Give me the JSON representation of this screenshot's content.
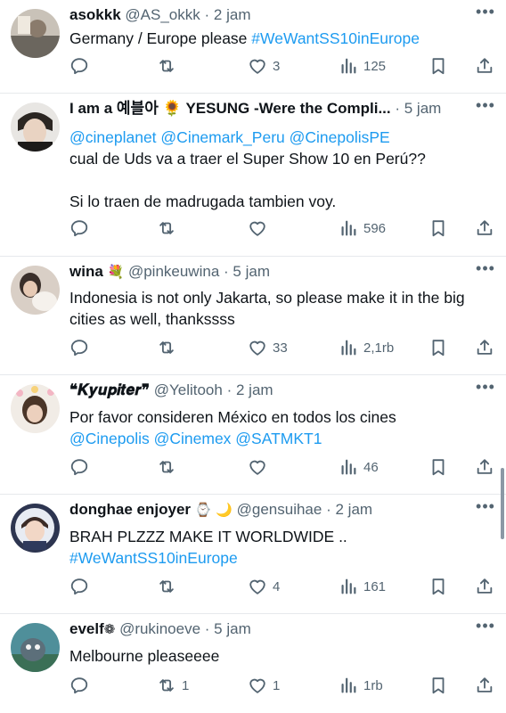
{
  "tweets": [
    {
      "name": "asokkk",
      "emoji": "",
      "handle": "@AS_okkk",
      "dot": "·",
      "time": "2 jam",
      "text_plain": "Germany / Europe please ",
      "text_link": "#WeWantSS10inEurope",
      "reply": "",
      "retweet": "",
      "like": "3",
      "views": "125"
    },
    {
      "name": "I am a 예블아 🌻 YESUNG -Were the Compli...",
      "emoji": "",
      "handle": "",
      "dot": "",
      "time": "5 jam",
      "mentions": "@cineplanet @Cinemark_Peru @CinepolisPE",
      "line2": "cual de Uds va a traer el Super Show 10 en Perú??",
      "line3": "Si lo traen de madrugada tambien voy.",
      "reply": "",
      "retweet": "",
      "like": "",
      "views": "596"
    },
    {
      "name": "wina",
      "emoji": "💐",
      "handle": "@pinkeuwina",
      "dot": "·",
      "time": "5 jam",
      "text": "Indonesia is not only Jakarta, so please make it in the big cities as well, thankssss",
      "reply": "",
      "retweet": "",
      "like": "33",
      "views": "2,1rb"
    },
    {
      "name": "❝𝑲𝒚𝒖𝒑𝒊𝒕𝒆𝒓❞",
      "emoji": "",
      "handle": "@Yelitooh",
      "dot": "·",
      "time": "2 jam",
      "text": "Por favor consideren México en todos los cines",
      "mentions": "@Cinepolis @Cinemex @SATMKT1",
      "reply": "",
      "retweet": "",
      "like": "",
      "views": "46"
    },
    {
      "name": "donghae enjoyer",
      "emoji": "⌚ 🌙",
      "handle": "@gensuihae",
      "dot": "·",
      "time": "2 jam",
      "text": "BRAH PLZZZ MAKE IT WORLDWIDE ..",
      "hashtag": "#WeWantSS10inEurope",
      "reply": "",
      "retweet": "",
      "like": "4",
      "views": "161"
    },
    {
      "name": "evelf",
      "emoji": "❁",
      "handle": "@rukinoeve",
      "dot": "·",
      "time": "5 jam",
      "text": "Melbourne pleaseeee",
      "reply": "",
      "retweet": "1",
      "like": "1",
      "views": "1rb"
    }
  ],
  "icons": {
    "more": "more-icon",
    "reply": "reply-icon",
    "retweet": "retweet-icon",
    "like": "heart-icon",
    "views": "views-icon",
    "bookmark": "bookmark-icon",
    "share": "share-icon"
  },
  "colors": {
    "link": "#1d9bf0",
    "muted": "#536471",
    "text": "#0f1419",
    "divider": "#e6e9ec"
  }
}
